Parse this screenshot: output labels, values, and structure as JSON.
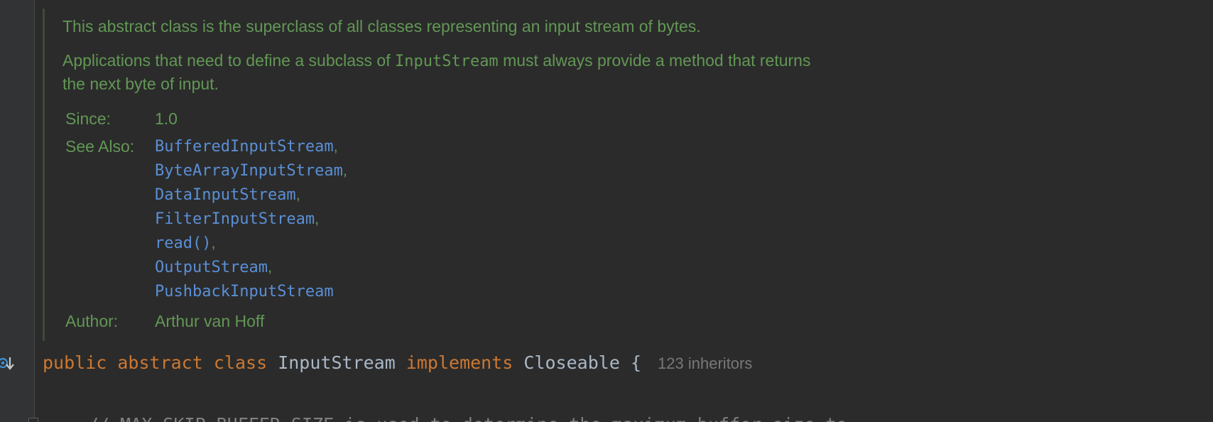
{
  "doc_comment": {
    "para1": "This abstract class is the superclass of all classes representing an input stream of bytes.",
    "para2_before": "Applications that need to define a subclass of ",
    "para2_code": "InputStream",
    "para2_after": " must always provide a method that returns",
    "para2_line2": "the next byte of input.",
    "since_label": "Since:",
    "since_value": "1.0",
    "see_also_label": "See Also:",
    "see_also": [
      {
        "link": "BufferedInputStream",
        "sep": ","
      },
      {
        "link": "ByteArrayInputStream",
        "sep": ","
      },
      {
        "link": "DataInputStream",
        "sep": ","
      },
      {
        "link": "FilterInputStream",
        "sep": ","
      },
      {
        "link": "read()",
        "sep": ","
      },
      {
        "link": "OutputStream",
        "sep": ","
      },
      {
        "link": "PushbackInputStream",
        "sep": ""
      }
    ],
    "author_label": "Author:",
    "author_value": "Arthur van Hoff"
  },
  "code": {
    "kw_public": "public",
    "kw_abstract": "abstract",
    "kw_class": "class",
    "class_name": "InputStream",
    "kw_implements": "implements",
    "interface_name": "Closeable",
    "brace": "{",
    "inheritors_hint": "123 inheritors",
    "comment": "// MAX_SKIP_BUFFER_SIZE is used to determine the maximum buffer size to"
  },
  "gutter": {
    "icon": "implemented-overridden-icon"
  },
  "colors": {
    "background": "#2b2b2b",
    "doc_text": "#629755",
    "link": "#5a8fd6",
    "keyword": "#cc7832",
    "identifier": "#a9b7c6",
    "hint": "#787878",
    "comment": "#808080"
  }
}
